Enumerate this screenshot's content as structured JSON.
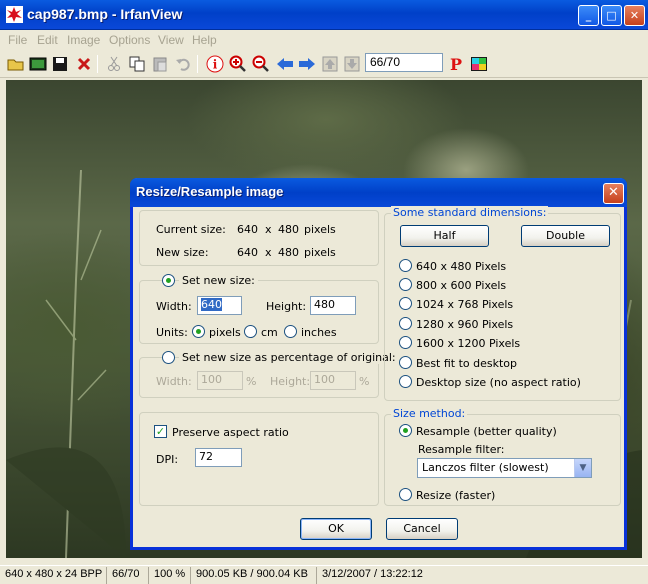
{
  "window": {
    "title": "cap987.bmp - IrfanView"
  },
  "menu": [
    "File",
    "Edit",
    "Image",
    "Options",
    "View",
    "Help"
  ],
  "toolbar": {
    "page_field": "66/70"
  },
  "status": {
    "dimensions": "640 x 480 x 24 BPP",
    "index": "66/70",
    "zoom": "100 %",
    "size": "900.05 KB / 900.04 KB",
    "date": "3/12/2007 / 13:22:12"
  },
  "dialog": {
    "title": "Resize/Resample image",
    "current_size_label": "Current size:",
    "current_size_w": "640",
    "current_size_x": "x",
    "current_size_h": "480",
    "current_size_unit": "pixels",
    "new_size_label": "New size:",
    "new_size_w": "640",
    "new_size_x": "x",
    "new_size_h": "480",
    "new_size_unit": "pixels",
    "set_new_size_label": "Set new size:",
    "width_label": "Width:",
    "width_value": "640",
    "height_label": "Height:",
    "height_value": "480",
    "units_label": "Units:",
    "unit_pixels": "pixels",
    "unit_cm": "cm",
    "unit_inches": "inches",
    "percent_label": "Set new size as percentage of original:",
    "pct_width_label": "Width:",
    "pct_width_value": "100",
    "pct_height_label": "Height:",
    "pct_height_value": "100",
    "pct_sign": "%",
    "preserve_label": "Preserve aspect ratio",
    "dpi_label": "DPI:",
    "dpi_value": "72",
    "std_group_label": "Some standard dimensions:",
    "half_button": "Half",
    "double_button": "Double",
    "std_options": [
      "640 x 480 Pixels",
      "800 x 600 Pixels",
      "1024 x 768 Pixels",
      "1280 x 960 Pixels",
      "1600 x 1200 Pixels",
      "Best fit to desktop",
      "Desktop size (no aspect ratio)"
    ],
    "method_group_label": "Size method:",
    "resample_label": "Resample (better quality)",
    "filter_label": "Resample filter:",
    "filter_value": "Lanczos filter (slowest)",
    "resize_label": "Resize (faster)",
    "ok_button": "OK",
    "cancel_button": "Cancel"
  }
}
